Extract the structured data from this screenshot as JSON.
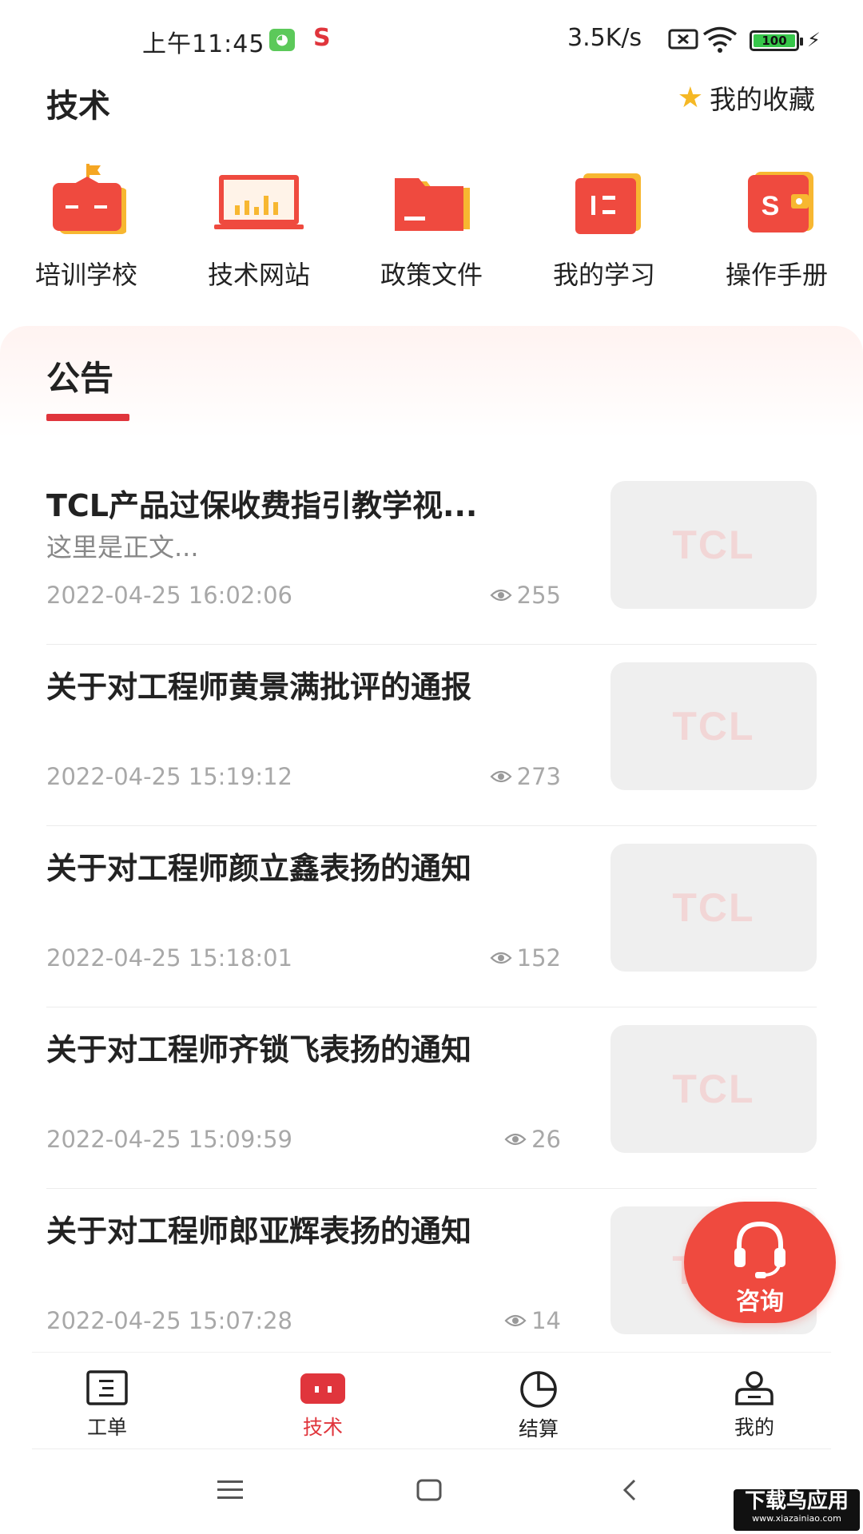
{
  "status_bar": {
    "time": "上午11:45",
    "network_speed": "3.5K/s",
    "battery": "100"
  },
  "header": {
    "title": "技术",
    "favorites_label": "我的收藏"
  },
  "shortcuts": [
    {
      "label": "培训学校",
      "icon": "school-icon"
    },
    {
      "label": "技术网站",
      "icon": "website-icon"
    },
    {
      "label": "政策文件",
      "icon": "folder-icon"
    },
    {
      "label": "我的学习",
      "icon": "study-icon"
    },
    {
      "label": "操作手册",
      "icon": "manual-icon"
    }
  ],
  "announcements": {
    "tab_label": "公告",
    "thumb_text": "TCL",
    "items": [
      {
        "title": "TCL产品过保收费指引教学视...",
        "summary": "这里是正文...",
        "date": "2022-04-25 16:02:06",
        "views": "255"
      },
      {
        "title": "关于对工程师黄景满批评的通报",
        "summary": "",
        "date": "2022-04-25 15:19:12",
        "views": "273"
      },
      {
        "title": "关于对工程师颜立鑫表扬的通知",
        "summary": "",
        "date": "2022-04-25 15:18:01",
        "views": "152"
      },
      {
        "title": "关于对工程师齐锁飞表扬的通知",
        "summary": "",
        "date": "2022-04-25 15:09:59",
        "views": "26"
      },
      {
        "title": "关于对工程师郎亚辉表扬的通知",
        "summary": "",
        "date": "2022-04-25 15:07:28",
        "views": "14"
      }
    ]
  },
  "consult_button": {
    "label": "咨询"
  },
  "bottom_nav": [
    {
      "label": "工单",
      "active": false
    },
    {
      "label": "技术",
      "active": true
    },
    {
      "label": "结算",
      "active": false
    },
    {
      "label": "我的",
      "active": false
    }
  ],
  "watermark": {
    "line1": "下载鸟应用",
    "line2": "www.xiazainiao.com"
  },
  "colors": {
    "accent": "#e0353c",
    "star": "#f5b825",
    "fab": "#ef4a3f"
  }
}
